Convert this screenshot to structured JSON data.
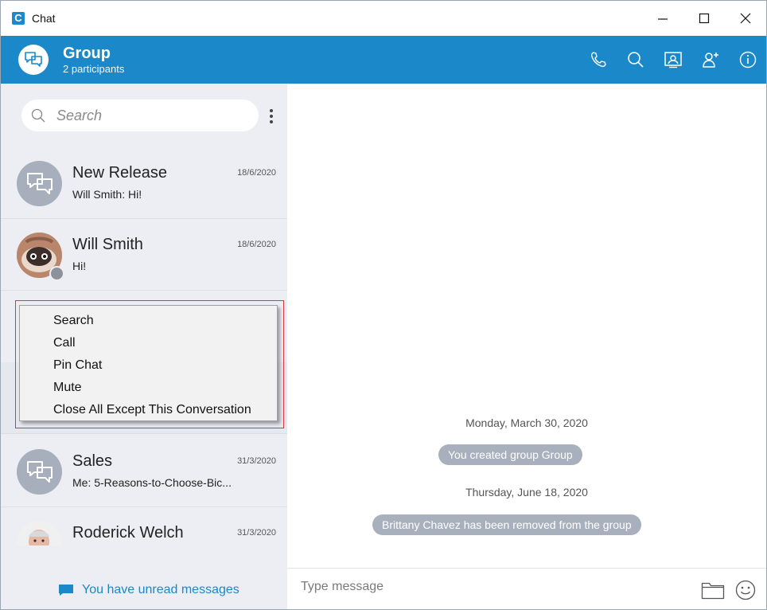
{
  "window": {
    "title": "Chat",
    "app_icon_letter": "C",
    "controls": {
      "minimize": "minimize-icon",
      "maximize": "maximize-icon",
      "close": "close-icon"
    }
  },
  "header": {
    "title": "Group",
    "subtitle": "2 participants",
    "actions": [
      "phone-icon",
      "search-icon",
      "screen-share-icon",
      "add-participant-icon",
      "info-icon"
    ],
    "background": "#1a88c9"
  },
  "sidebar": {
    "search_placeholder": "Search",
    "conversations": [
      {
        "name": "New Release",
        "preview": "Will Smith: Hi!",
        "date": "18/6/2020",
        "avatar": "group-chat-icon"
      },
      {
        "name": "Will Smith",
        "preview": "Hi!",
        "date": "18/6/2020",
        "avatar": "user-photo",
        "presence": "offline"
      },
      {
        "name": "Sales",
        "preview": "Me: 5-Reasons-to-Choose-Bic...",
        "date": "31/3/2020",
        "avatar": "group-chat-icon"
      },
      {
        "name": "Roderick Welch",
        "preview": "",
        "date": "31/3/2020",
        "avatar": "user-photo"
      }
    ],
    "unread_text": "You have unread messages"
  },
  "context_menu": {
    "items": [
      "Search",
      "Call",
      "Pin Chat",
      "Mute",
      "Close All Except This Conversation"
    ]
  },
  "messages": {
    "day1": "Monday, March 30, 2020",
    "event1": "You created group Group",
    "day2": "Thursday, June 18, 2020",
    "event2": "Brittany Chavez has been removed from the group"
  },
  "composer": {
    "placeholder": "Type message",
    "attach_icon": "folder-icon",
    "emoji_icon": "emoji-icon"
  }
}
